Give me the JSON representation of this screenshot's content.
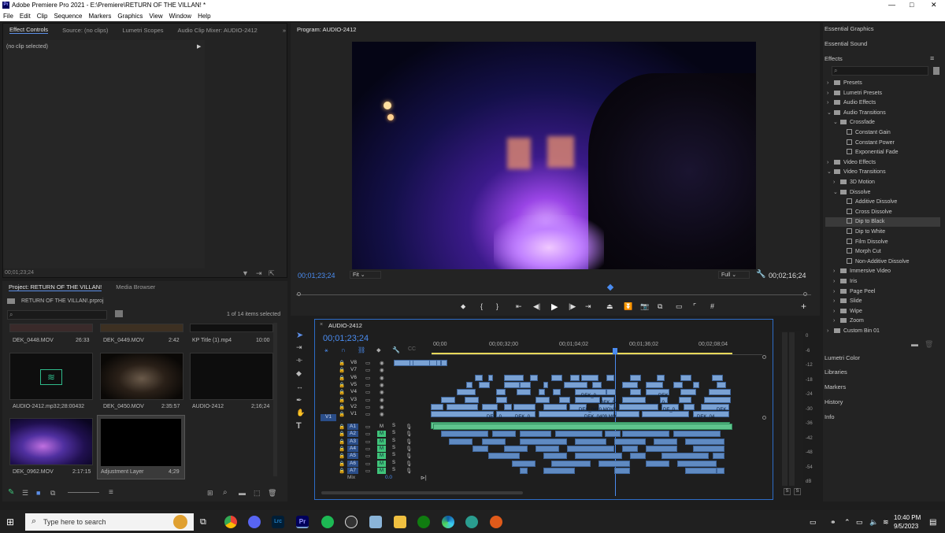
{
  "window": {
    "title": "Adobe Premiere Pro 2021 - E:\\Premiere\\RETURN OF THE VILLAN! *",
    "app_badge": "Pr",
    "controls": [
      "—",
      "□",
      "✕"
    ]
  },
  "menu": [
    "File",
    "Edit",
    "Clip",
    "Sequence",
    "Markers",
    "Graphics",
    "View",
    "Window",
    "Help"
  ],
  "effect_controls": {
    "tabs": [
      "Effect Controls",
      "Source: (no clips)",
      "Lumetri Scopes",
      "Audio Clip Mixer: AUDIO-2412"
    ],
    "overflow": "»",
    "no_clip": "(no clip selected)",
    "timecode": "00;01;23;24"
  },
  "project": {
    "tabs": [
      "Project: RETURN OF THE VILLAN!",
      "Media Browser"
    ],
    "file": "RETURN OF THE VILLAN!.prproj",
    "selection": "1 of 14 items selected",
    "items": [
      {
        "name": "DEK_0448.MOV",
        "dur": "26:33"
      },
      {
        "name": "DEK_0449.MOV",
        "dur": "2:42"
      },
      {
        "name": "KP Title (1).mp4",
        "dur": "10:00"
      },
      {
        "name": "AUDIO-2412.mp3",
        "dur": "2;28:00432"
      },
      {
        "name": "DEK_0450.MOV",
        "dur": "2:35:57"
      },
      {
        "name": "AUDIO-2412",
        "dur": "2;16;24"
      },
      {
        "name": "DEK_0962.MOV",
        "dur": "2:17:15"
      },
      {
        "name": "Adjustment Layer",
        "dur": "4;29"
      }
    ]
  },
  "program": {
    "title": "Program: AUDIO-2412",
    "timecode": "00;01;23;24",
    "fit": "Fit",
    "quality": "Full",
    "duration": "00;02;16;24"
  },
  "timeline": {
    "sequence": "AUDIO-2412",
    "timecode": "00;01;23;24",
    "ruler": [
      "00;00",
      "00;00;32;00",
      "00;01;04;02",
      "00;01;36;02",
      "00;02;08;04"
    ],
    "video_tracks": [
      "V8",
      "V7",
      "V6",
      "V5",
      "V4",
      "V3",
      "V2",
      "V1"
    ],
    "audio_tracks": [
      "A1",
      "A2",
      "A3",
      "A4",
      "A5",
      "A6",
      "A7"
    ],
    "mix": "Mix",
    "mix_value": "0.0",
    "source_patch": "V1",
    "m": "M",
    "s": "S",
    "clip_labels": [
      "DEK_0",
      "DEK_041",
      "DEK_0",
      "DEK",
      "DEK_0410.MOV1",
      "DE_0",
      "DEK",
      "DEK_0409.MO",
      "DEK_0",
      "DEK_0",
      "DEK_04"
    ]
  },
  "meters": {
    "scale": [
      "0",
      "-6",
      "-12",
      "-18",
      "-24",
      "-30",
      "-36",
      "-42",
      "-48",
      "-54",
      "dB"
    ],
    "solo": [
      "S",
      "S"
    ]
  },
  "right_panel": {
    "top": [
      "Essential Graphics",
      "Essential Sound"
    ],
    "effects_title": "Effects",
    "tree": [
      {
        "label": "Presets",
        "level": 0,
        "kind": "folder"
      },
      {
        "label": "Lumetri Presets",
        "level": 0,
        "kind": "folder"
      },
      {
        "label": "Audio Effects",
        "level": 0,
        "kind": "folder"
      },
      {
        "label": "Audio Transitions",
        "level": 0,
        "kind": "folder",
        "open": true
      },
      {
        "label": "Crossfade",
        "level": 1,
        "kind": "folder",
        "open": true
      },
      {
        "label": "Constant Gain",
        "level": 2,
        "kind": "fx"
      },
      {
        "label": "Constant Power",
        "level": 2,
        "kind": "fx"
      },
      {
        "label": "Exponential Fade",
        "level": 2,
        "kind": "fx"
      },
      {
        "label": "Video Effects",
        "level": 0,
        "kind": "folder"
      },
      {
        "label": "Video Transitions",
        "level": 0,
        "kind": "folder",
        "open": true
      },
      {
        "label": "3D Motion",
        "level": 1,
        "kind": "folder"
      },
      {
        "label": "Dissolve",
        "level": 1,
        "kind": "folder",
        "open": true
      },
      {
        "label": "Additive Dissolve",
        "level": 2,
        "kind": "fx"
      },
      {
        "label": "Cross Dissolve",
        "level": 2,
        "kind": "fx"
      },
      {
        "label": "Dip to Black",
        "level": 2,
        "kind": "fx",
        "selected": true
      },
      {
        "label": "Dip to White",
        "level": 2,
        "kind": "fx"
      },
      {
        "label": "Film Dissolve",
        "level": 2,
        "kind": "fx"
      },
      {
        "label": "Morph Cut",
        "level": 2,
        "kind": "fx"
      },
      {
        "label": "Non-Additive Dissolve",
        "level": 2,
        "kind": "fx"
      },
      {
        "label": "Immersive Video",
        "level": 1,
        "kind": "folder"
      },
      {
        "label": "Iris",
        "level": 1,
        "kind": "folder"
      },
      {
        "label": "Page Peel",
        "level": 1,
        "kind": "folder"
      },
      {
        "label": "Slide",
        "level": 1,
        "kind": "folder"
      },
      {
        "label": "Wipe",
        "level": 1,
        "kind": "folder"
      },
      {
        "label": "Zoom",
        "level": 1,
        "kind": "folder"
      },
      {
        "label": "Custom Bin 01",
        "level": 0,
        "kind": "folder"
      }
    ],
    "bottom": [
      "Lumetri Color",
      "Libraries",
      "Markers",
      "History",
      "Info"
    ]
  },
  "taskbar": {
    "search": "Type here to search",
    "time": "10:40 PM",
    "date": "9/5/2023",
    "lrc": "Lrc",
    "pr": "Pr"
  }
}
